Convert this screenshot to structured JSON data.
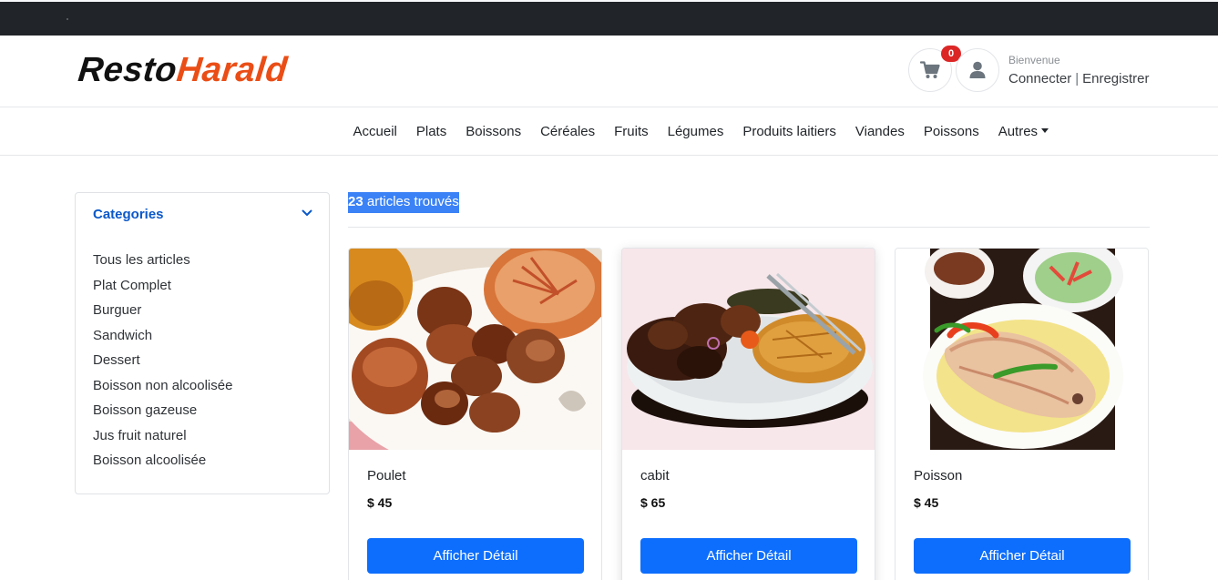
{
  "brand": {
    "name_part1": "Resto",
    "name_part2": "Harald",
    "color_dark": "#111111",
    "color_accent": "#ea4e16"
  },
  "header": {
    "cart_icon": "cart-icon",
    "cart_count": "0",
    "user_icon": "user-icon",
    "welcome": "Bienvenue",
    "login": "Connecter",
    "separator": "|",
    "register": "Enregistrer"
  },
  "nav": {
    "items": [
      "Accueil",
      "Plats",
      "Boissons",
      "Céréales",
      "Fruits",
      "Légumes",
      "Produits laitiers",
      "Viandes",
      "Poissons",
      "Autres"
    ]
  },
  "sidebar": {
    "title": "Categories",
    "toggle_icon": "chevron-down-icon",
    "items": [
      "Tous les articles",
      "Plat Complet",
      "Burguer",
      "Sandwich",
      "Dessert",
      "Boisson non alcoolisée",
      "Boisson gazeuse",
      "Jus fruit naturel",
      "Boisson alcoolisée"
    ]
  },
  "results": {
    "count": "23",
    "label": "articles trouvés"
  },
  "products": [
    {
      "name": "Poulet",
      "price": "$ 45",
      "button": "Afficher Détail",
      "image": "fried-meat-plate-photo"
    },
    {
      "name": "cabit",
      "price": "$ 65",
      "button": "Afficher Détail",
      "image": "goat-rice-plate-photo"
    },
    {
      "name": "Poisson",
      "price": "$ 45",
      "button": "Afficher Détail",
      "image": "fish-plate-photo"
    }
  ],
  "colors": {
    "primary": "#0d6efd",
    "topbar": "#212529",
    "badge": "#dc2626",
    "category_title": "#0a58ca",
    "highlight": "#3b82f6"
  }
}
